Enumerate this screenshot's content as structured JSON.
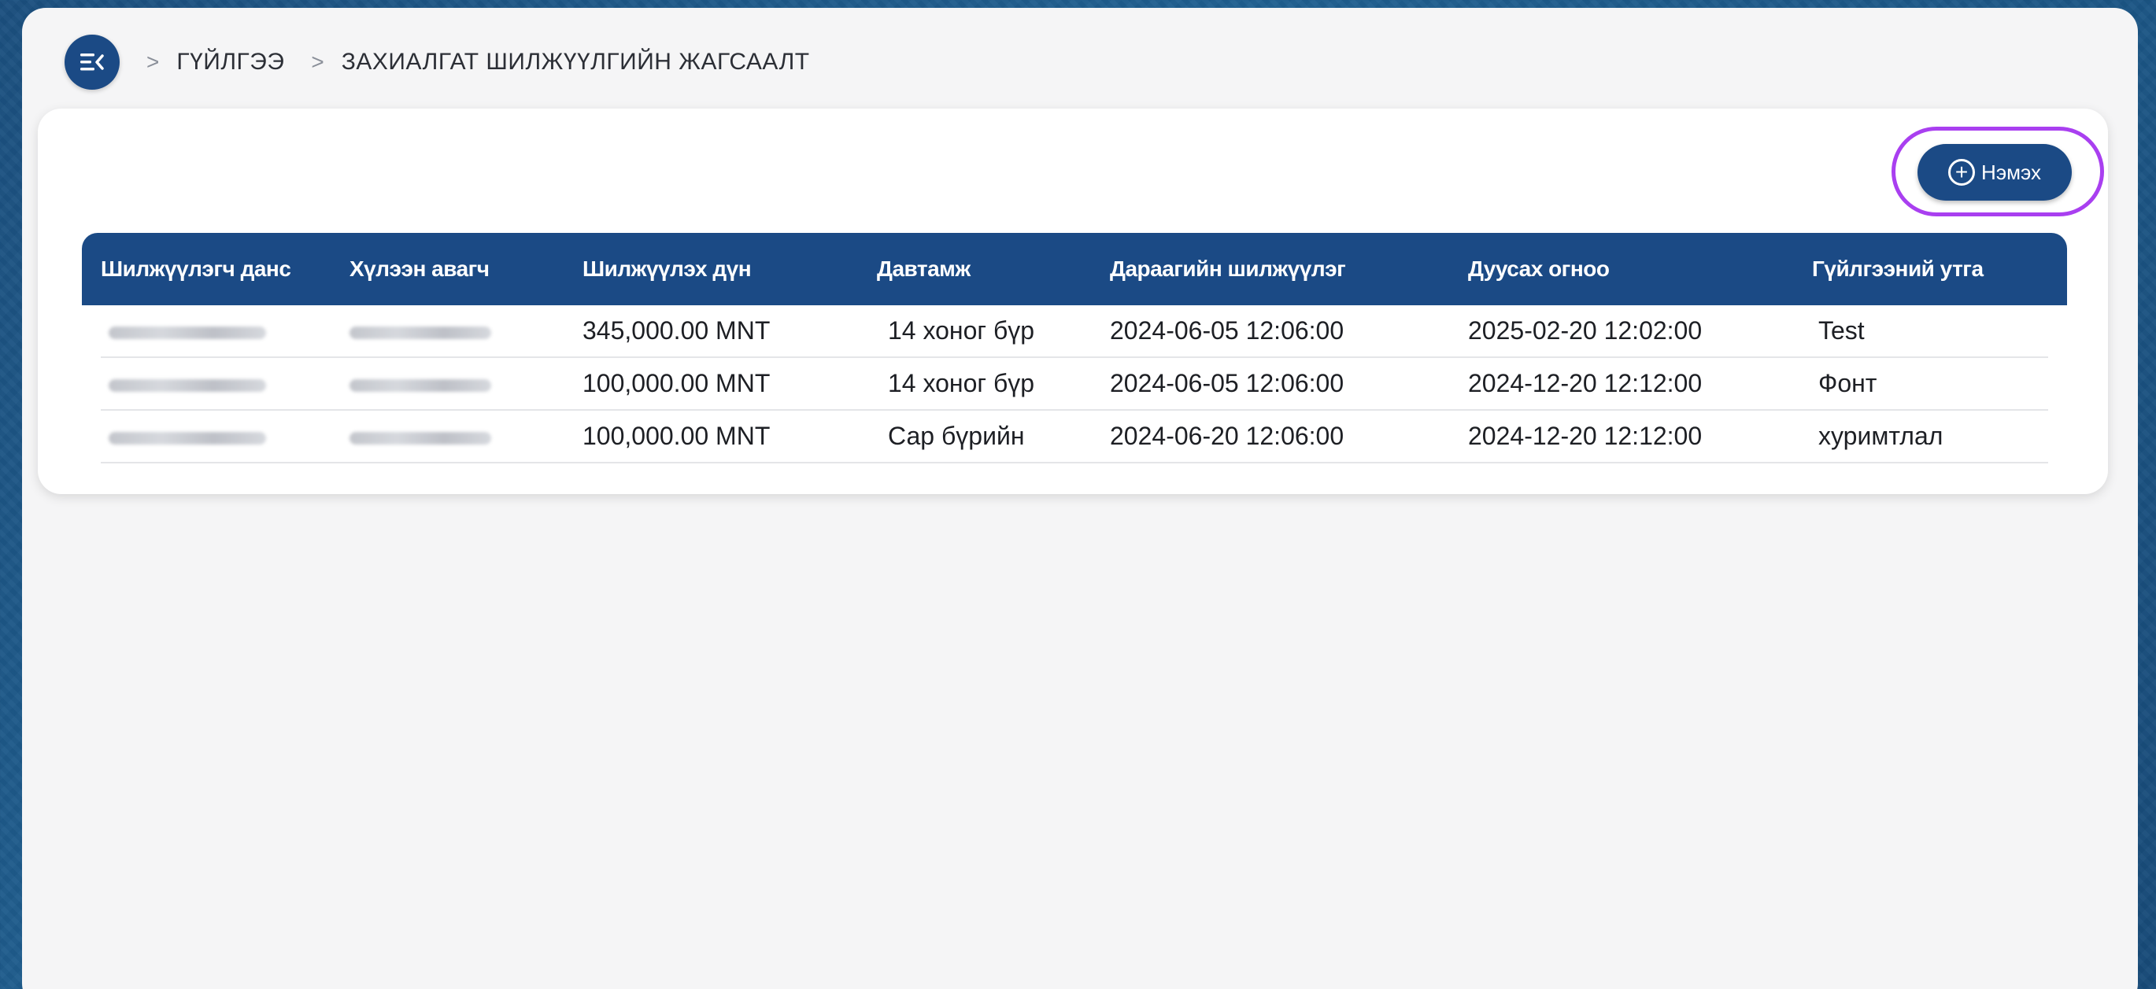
{
  "breadcrumb": {
    "items": [
      "ГҮЙЛГЭЭ",
      "ЗАХИАЛГАТ ШИЛЖҮҮЛГИЙН ЖАГСААЛТ"
    ],
    "separator": ">"
  },
  "actions": {
    "add_label": "Нэмэх"
  },
  "table": {
    "columns": [
      "Шилжүүлэгч данс",
      "Хүлээн авагч",
      "Шилжүүлэх дүн",
      "Давтамж",
      "Дараагийн шилжүүлэг",
      "Дуусах огноо",
      "Гүйлгээний утга"
    ],
    "rows": [
      {
        "amount": "345,000.00 MNT",
        "frequency": "14 хоног бүр",
        "next_transfer": "2024-06-05 12:06:00",
        "end_date": "2025-02-20 12:02:00",
        "description": "Test"
      },
      {
        "amount": "100,000.00 MNT",
        "frequency": "14 хоног бүр",
        "next_transfer": "2024-06-05 12:06:00",
        "end_date": "2024-12-20 12:12:00",
        "description": "Фонт"
      },
      {
        "amount": "100,000.00 MNT",
        "frequency": "Сар бүрийн",
        "next_transfer": "2024-06-20 12:06:00",
        "end_date": "2024-12-20 12:12:00",
        "description": "хуримтлал"
      }
    ]
  },
  "colors": {
    "primary": "#1b4a85",
    "highlight": "#a93ff0",
    "panel": "#f5f5f6"
  }
}
